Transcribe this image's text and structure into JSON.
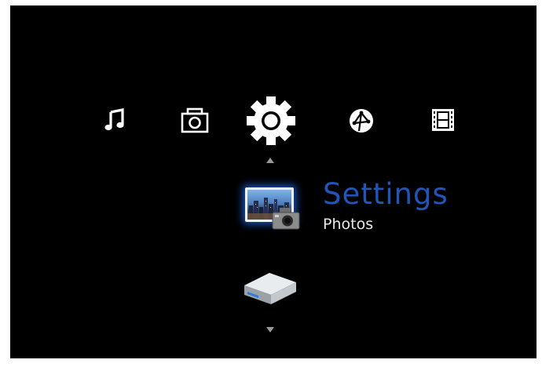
{
  "menu": {
    "items": [
      {
        "id": "music",
        "icon": "music-note-icon"
      },
      {
        "id": "photos",
        "icon": "camera-icon"
      },
      {
        "id": "settings",
        "icon": "gear-icon",
        "selected": true
      },
      {
        "id": "internet",
        "icon": "globe-icon"
      },
      {
        "id": "videos",
        "icon": "film-icon"
      }
    ]
  },
  "submenu": {
    "title": "Settings",
    "subtitle": "Photos",
    "items": [
      {
        "id": "photos-settings",
        "icon": "photo-settings-icon",
        "selected": true
      },
      {
        "id": "storage",
        "icon": "hard-drive-icon"
      }
    ]
  },
  "colors": {
    "background": "#000000",
    "accent": "#1f56b8",
    "text": "#e8e8e8",
    "glow": "#2a6eff"
  }
}
